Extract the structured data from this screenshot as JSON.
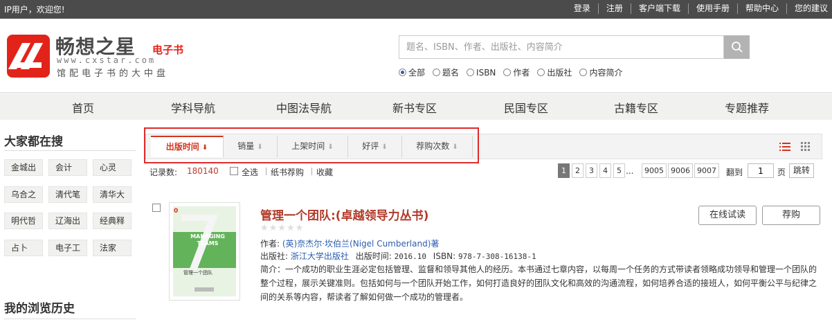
{
  "topbar": {
    "greeting": "IP用户，欢迎您!",
    "links": [
      "登录",
      "注册",
      "客户端下载",
      "使用手册",
      "帮助中心",
      "您的建议"
    ]
  },
  "header": {
    "brand_name": "畅想之星",
    "brand_sub": "电子书",
    "brand_url": "www.cxstar.com",
    "brand_slogan": "馆配电子书的大中盘",
    "search_placeholder": "题名、ISBN、作者、出版社、内容简介",
    "search_options": [
      "全部",
      "题名",
      "ISBN",
      "作者",
      "出版社",
      "内容简介"
    ],
    "search_selected": "全部"
  },
  "nav": [
    "首页",
    "学科导航",
    "中图法导航",
    "新书专区",
    "民国专区",
    "古籍专区",
    "专题推荐"
  ],
  "sidebar": {
    "popular_title": "大家都在搜",
    "popular_tags": [
      "金城出",
      "会计",
      "心灵",
      "乌合之",
      "清代笔",
      "清华大",
      "明代哲",
      "辽海出",
      "经典释",
      "占卜",
      "电子工",
      "法家"
    ],
    "history_title": "我的浏览历史"
  },
  "sort": {
    "items": [
      "出版时间",
      "销量",
      "上架时间",
      "好评",
      "荐购次数"
    ],
    "active": "出版时间"
  },
  "records": {
    "label": "记录数:",
    "count": "180140",
    "select_all": "全选",
    "paper_recommend": "纸书荐购",
    "favorite": "收藏"
  },
  "pager": {
    "pages": [
      "1",
      "2",
      "3",
      "4",
      "5"
    ],
    "ellipsis": "...",
    "tail_pages": [
      "9005",
      "9006",
      "9007"
    ],
    "current": "1",
    "goto_label": "翻到",
    "goto_value": "1",
    "page_unit": "页",
    "go_label": "跳转"
  },
  "book": {
    "badge": "0",
    "title": "管理一个团队:(卓越领导力丛书)",
    "rating_stars": 0,
    "author_label": "作者:",
    "author": "(英)奈杰尔·坎伯兰(Nigel Cumberland)著",
    "publisher_label": "出版社:",
    "publisher": "浙江大学出版社",
    "pubdate_label": "出版时间:",
    "pubdate": "2016.10",
    "isbn_label": "ISBN:",
    "isbn": "978-7-308-16138-1",
    "summary": "简介：一个成功的职业生涯必定包括管理、监督和领导其他人的经历。本书通过七章内容，以每周一个任务的方式带读者领略成功领导和管理一个团队的整个过程，展示关键准则。包括如何与一个团队开始工作，如何打造良好的团队文化和高效的沟通流程，如何培养合适的接班人，如何平衡公平与纪律之间的关系等内容，帮读者了解如何做一个成功的管理者。",
    "cover_number": "7",
    "cover_title": "MANAGING TEAMS",
    "cover_cn": "管理一个团队",
    "preview_label": "在线试读",
    "buy_label": "荐购"
  },
  "colors": {
    "accent_red": "#d2331f",
    "link_blue": "#2a5db0",
    "topbar_bg": "#4b4b4b"
  }
}
